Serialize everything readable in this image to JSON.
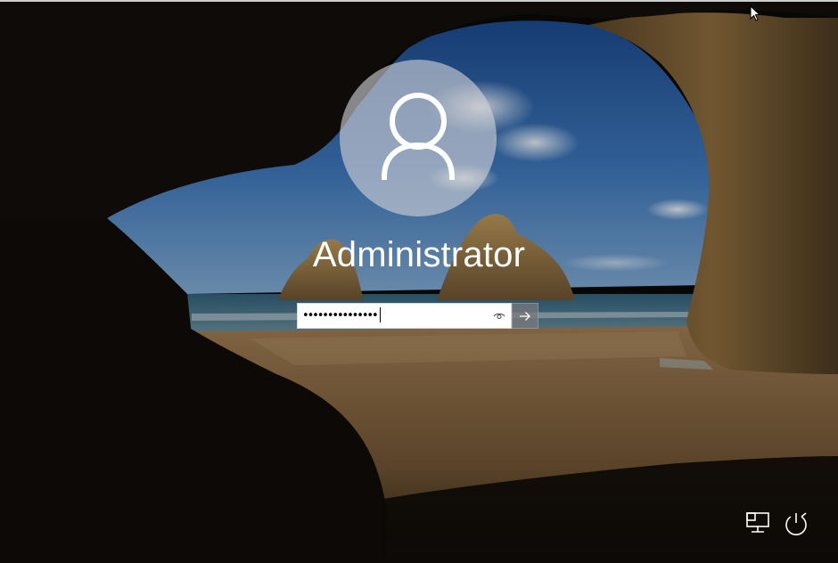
{
  "lockscreen": {
    "username": "Administrator",
    "password_masked": "•••••••••••••••",
    "password_reveal_icon": "eye-icon",
    "submit_icon": "arrow-right-icon"
  },
  "system_buttons": {
    "network_icon": "network-icon",
    "power_icon": "power-icon"
  },
  "colors": {
    "sky": "#2f63a6",
    "sand": "#8a6a45",
    "cave": "#0b0907",
    "text": "#ffffff",
    "avatar_bg": "#c6c6cb"
  }
}
